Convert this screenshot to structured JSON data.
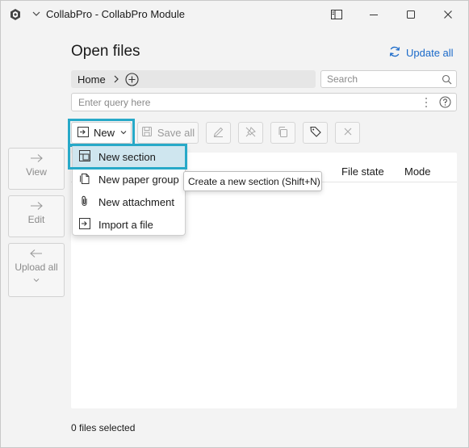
{
  "window": {
    "title": "CollabPro - CollabPro Module"
  },
  "header": {
    "title": "Open files",
    "update_all": "Update all"
  },
  "breadcrumb": {
    "items": [
      "Home"
    ]
  },
  "search": {
    "placeholder": "Search"
  },
  "query": {
    "placeholder": "Enter query here"
  },
  "toolbar": {
    "new_label": "New",
    "save_all_label": "Save all",
    "buttons": [
      "edit-icon",
      "unpin-icon",
      "copy-icon",
      "tag-icon",
      "close-icon"
    ]
  },
  "sidebar": {
    "items": [
      {
        "label": "View",
        "icon": "arrow-right-icon"
      },
      {
        "label": "Edit",
        "icon": "arrow-right-icon"
      },
      {
        "label": "Upload all",
        "icon": "arrow-left-icon"
      }
    ]
  },
  "table": {
    "columns": [
      "File state",
      "Mode"
    ]
  },
  "menu": {
    "items": [
      {
        "label": "New section",
        "icon": "new-section-icon"
      },
      {
        "label": "New paper group",
        "icon": "paper-group-icon"
      },
      {
        "label": "New attachment",
        "icon": "paperclip-icon"
      },
      {
        "label": "Import a file",
        "icon": "import-icon"
      }
    ]
  },
  "tooltip": {
    "text": "Create a new section (Shift+N)"
  },
  "status": {
    "text": "0 files selected"
  },
  "colors": {
    "accent": "#1b6ac9",
    "highlight_border": "#27a9c8",
    "menu_active": "#cfe6ef"
  }
}
